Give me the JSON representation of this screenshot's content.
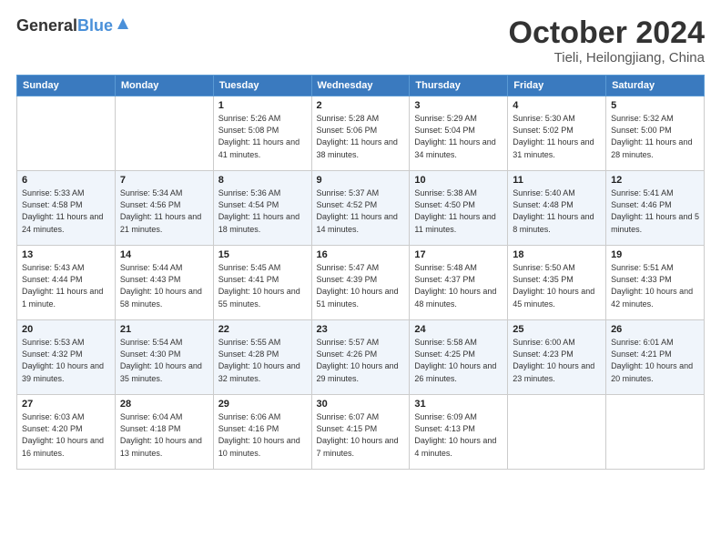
{
  "header": {
    "logo": {
      "general": "General",
      "blue": "Blue"
    },
    "title": "October 2024",
    "location": "Tieli, Heilongjiang, China"
  },
  "calendar": {
    "days_of_week": [
      "Sunday",
      "Monday",
      "Tuesday",
      "Wednesday",
      "Thursday",
      "Friday",
      "Saturday"
    ],
    "weeks": [
      [
        {
          "day": "",
          "info": ""
        },
        {
          "day": "",
          "info": ""
        },
        {
          "day": "1",
          "info": "Sunrise: 5:26 AM\nSunset: 5:08 PM\nDaylight: 11 hours and 41 minutes."
        },
        {
          "day": "2",
          "info": "Sunrise: 5:28 AM\nSunset: 5:06 PM\nDaylight: 11 hours and 38 minutes."
        },
        {
          "day": "3",
          "info": "Sunrise: 5:29 AM\nSunset: 5:04 PM\nDaylight: 11 hours and 34 minutes."
        },
        {
          "day": "4",
          "info": "Sunrise: 5:30 AM\nSunset: 5:02 PM\nDaylight: 11 hours and 31 minutes."
        },
        {
          "day": "5",
          "info": "Sunrise: 5:32 AM\nSunset: 5:00 PM\nDaylight: 11 hours and 28 minutes."
        }
      ],
      [
        {
          "day": "6",
          "info": "Sunrise: 5:33 AM\nSunset: 4:58 PM\nDaylight: 11 hours and 24 minutes."
        },
        {
          "day": "7",
          "info": "Sunrise: 5:34 AM\nSunset: 4:56 PM\nDaylight: 11 hours and 21 minutes."
        },
        {
          "day": "8",
          "info": "Sunrise: 5:36 AM\nSunset: 4:54 PM\nDaylight: 11 hours and 18 minutes."
        },
        {
          "day": "9",
          "info": "Sunrise: 5:37 AM\nSunset: 4:52 PM\nDaylight: 11 hours and 14 minutes."
        },
        {
          "day": "10",
          "info": "Sunrise: 5:38 AM\nSunset: 4:50 PM\nDaylight: 11 hours and 11 minutes."
        },
        {
          "day": "11",
          "info": "Sunrise: 5:40 AM\nSunset: 4:48 PM\nDaylight: 11 hours and 8 minutes."
        },
        {
          "day": "12",
          "info": "Sunrise: 5:41 AM\nSunset: 4:46 PM\nDaylight: 11 hours and 5 minutes."
        }
      ],
      [
        {
          "day": "13",
          "info": "Sunrise: 5:43 AM\nSunset: 4:44 PM\nDaylight: 11 hours and 1 minute."
        },
        {
          "day": "14",
          "info": "Sunrise: 5:44 AM\nSunset: 4:43 PM\nDaylight: 10 hours and 58 minutes."
        },
        {
          "day": "15",
          "info": "Sunrise: 5:45 AM\nSunset: 4:41 PM\nDaylight: 10 hours and 55 minutes."
        },
        {
          "day": "16",
          "info": "Sunrise: 5:47 AM\nSunset: 4:39 PM\nDaylight: 10 hours and 51 minutes."
        },
        {
          "day": "17",
          "info": "Sunrise: 5:48 AM\nSunset: 4:37 PM\nDaylight: 10 hours and 48 minutes."
        },
        {
          "day": "18",
          "info": "Sunrise: 5:50 AM\nSunset: 4:35 PM\nDaylight: 10 hours and 45 minutes."
        },
        {
          "day": "19",
          "info": "Sunrise: 5:51 AM\nSunset: 4:33 PM\nDaylight: 10 hours and 42 minutes."
        }
      ],
      [
        {
          "day": "20",
          "info": "Sunrise: 5:53 AM\nSunset: 4:32 PM\nDaylight: 10 hours and 39 minutes."
        },
        {
          "day": "21",
          "info": "Sunrise: 5:54 AM\nSunset: 4:30 PM\nDaylight: 10 hours and 35 minutes."
        },
        {
          "day": "22",
          "info": "Sunrise: 5:55 AM\nSunset: 4:28 PM\nDaylight: 10 hours and 32 minutes."
        },
        {
          "day": "23",
          "info": "Sunrise: 5:57 AM\nSunset: 4:26 PM\nDaylight: 10 hours and 29 minutes."
        },
        {
          "day": "24",
          "info": "Sunrise: 5:58 AM\nSunset: 4:25 PM\nDaylight: 10 hours and 26 minutes."
        },
        {
          "day": "25",
          "info": "Sunrise: 6:00 AM\nSunset: 4:23 PM\nDaylight: 10 hours and 23 minutes."
        },
        {
          "day": "26",
          "info": "Sunrise: 6:01 AM\nSunset: 4:21 PM\nDaylight: 10 hours and 20 minutes."
        }
      ],
      [
        {
          "day": "27",
          "info": "Sunrise: 6:03 AM\nSunset: 4:20 PM\nDaylight: 10 hours and 16 minutes."
        },
        {
          "day": "28",
          "info": "Sunrise: 6:04 AM\nSunset: 4:18 PM\nDaylight: 10 hours and 13 minutes."
        },
        {
          "day": "29",
          "info": "Sunrise: 6:06 AM\nSunset: 4:16 PM\nDaylight: 10 hours and 10 minutes."
        },
        {
          "day": "30",
          "info": "Sunrise: 6:07 AM\nSunset: 4:15 PM\nDaylight: 10 hours and 7 minutes."
        },
        {
          "day": "31",
          "info": "Sunrise: 6:09 AM\nSunset: 4:13 PM\nDaylight: 10 hours and 4 minutes."
        },
        {
          "day": "",
          "info": ""
        },
        {
          "day": "",
          "info": ""
        }
      ]
    ]
  }
}
